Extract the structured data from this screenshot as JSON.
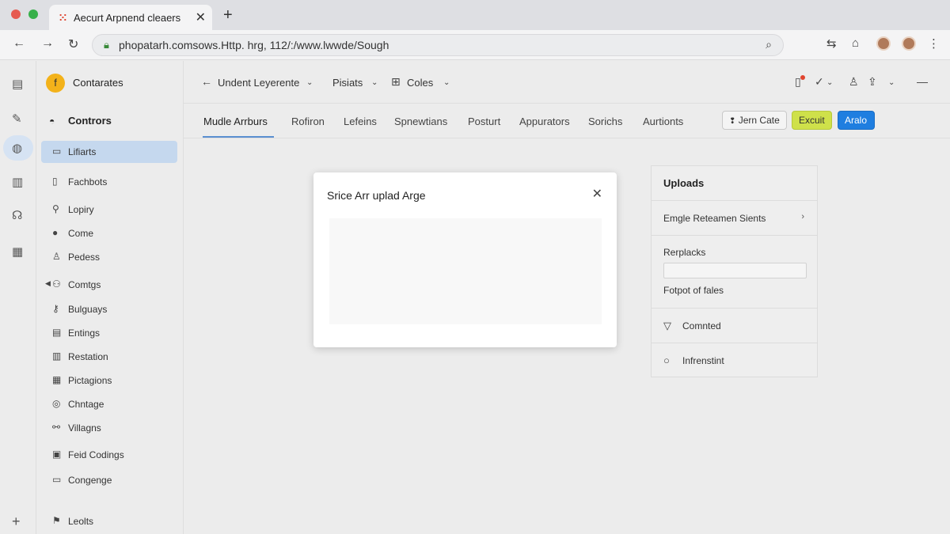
{
  "browser": {
    "tab_title": "Aecurt Arpnend cleaers",
    "url": "phopatarh.comsows.Http. hrg, 112/:/www.lwwde/Sough"
  },
  "sidebar": {
    "app_badge": "f",
    "app_name": "Contarates",
    "section_title": "Contrors",
    "items": [
      {
        "label": "Lifiarts"
      },
      {
        "label": "Fachbots"
      },
      {
        "label": "Lopiry"
      },
      {
        "label": "Come"
      },
      {
        "label": "Pedess"
      },
      {
        "label": "Comtgs"
      },
      {
        "label": "Bulguays"
      },
      {
        "label": "Entings"
      },
      {
        "label": "Restation"
      },
      {
        "label": "Pictagions"
      },
      {
        "label": "Chntage"
      },
      {
        "label": "Villagns"
      },
      {
        "label": "Feid Codings"
      },
      {
        "label": "Congenge"
      }
    ],
    "footer_label": "Leolts"
  },
  "main": {
    "header": {
      "back_label": "Undent Leyerente",
      "middle_label": "Pisiats",
      "cols_label": "Coles"
    },
    "tabs": [
      {
        "label": "Mudle Arrburs"
      },
      {
        "label": "Rofiron"
      },
      {
        "label": "Lefeins"
      },
      {
        "label": "Spnewtians"
      },
      {
        "label": "Posturt"
      },
      {
        "label": "Appurators"
      },
      {
        "label": "Sorichs"
      },
      {
        "label": "Aurtionts"
      }
    ],
    "actions": {
      "outline_label": "Jern Cate",
      "yellow_label": "Excuit",
      "blue_label": "Aralo"
    }
  },
  "modal": {
    "title": "Srice Arr uplad Arge"
  },
  "panel": {
    "title": "Uploads",
    "row1": "Emgle Reteamen Sients",
    "row2_label": "Rerplacks",
    "row2_sub": "Fotpot of fales",
    "row3": "Comnted",
    "row4": "Infrenstint"
  },
  "colors": {
    "accent_blue": "#1f7ee0",
    "accent_yellow": "#cfe14a",
    "active_item": "#c5d8ee",
    "app_badge": "#f3b21a"
  }
}
